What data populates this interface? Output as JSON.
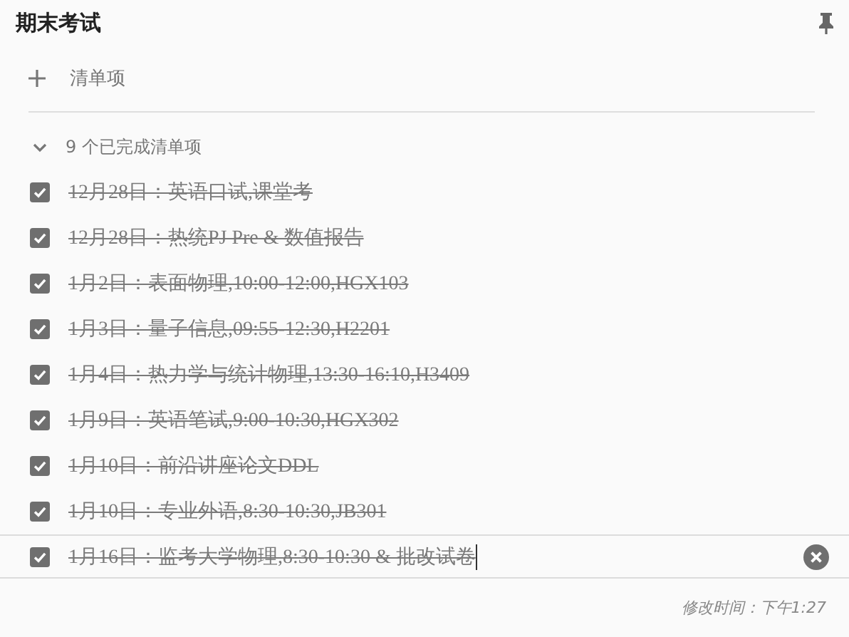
{
  "note": {
    "title": "期末考试"
  },
  "add_item": {
    "placeholder": "清单项"
  },
  "completed": {
    "label": "9 个已完成清单项",
    "expanded": true,
    "items": [
      {
        "text": "12月28日：英语口试,课堂考",
        "checked": true,
        "focused": false
      },
      {
        "text": "12月28日：热统PJ Pre & 数值报告",
        "checked": true,
        "focused": false
      },
      {
        "text": "1月2日：表面物理,10:00-12:00,HGX103",
        "checked": true,
        "focused": false
      },
      {
        "text": "1月3日：量子信息,09:55-12:30,H2201",
        "checked": true,
        "focused": false
      },
      {
        "text": "1月4日：热力学与统计物理,13:30-16:10,H3409",
        "checked": true,
        "focused": false
      },
      {
        "text": "1月9日：英语笔试,9:00-10:30,HGX302",
        "checked": true,
        "focused": false
      },
      {
        "text": "1月10日：前沿讲座论文DDL",
        "checked": true,
        "focused": false
      },
      {
        "text": "1月10日：专业外语,8:30-10:30,JB301",
        "checked": true,
        "focused": false
      },
      {
        "text": "1月16日：监考大学物理,8:30-10:30 & 批改试卷",
        "checked": true,
        "focused": true
      }
    ]
  },
  "footer": {
    "edited": "修改时间：下午1:27"
  }
}
